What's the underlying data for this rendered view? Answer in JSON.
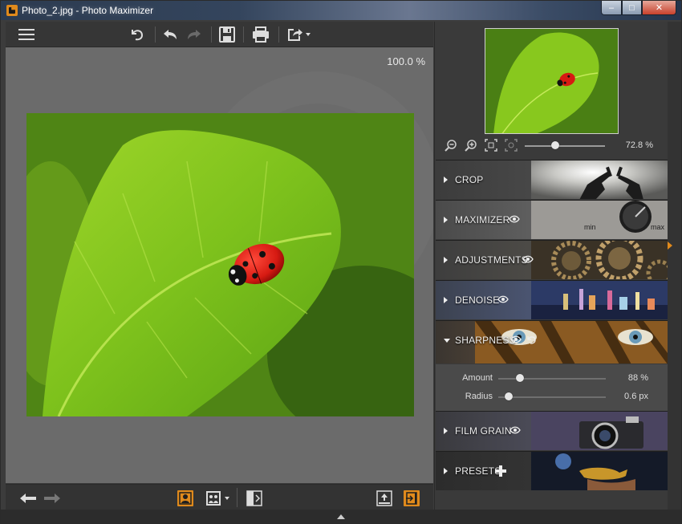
{
  "window": {
    "title": "Photo_2.jpg - Photo Maximizer",
    "controls": {
      "minimize": "–",
      "maximize": "□",
      "close": "✕"
    }
  },
  "toolbar": {
    "items": [
      "menu-icon",
      "undo-all-icon",
      "undo-icon",
      "redo-icon",
      "save-icon",
      "print-icon",
      "export-icon"
    ]
  },
  "canvas": {
    "zoom": "100.0 %"
  },
  "navigator": {
    "zoom": "72.8 %",
    "zoom_level": 0.38
  },
  "sections": [
    {
      "label": "CROP",
      "has_eye": false
    },
    {
      "label": "MAXIMIZER",
      "has_eye": true,
      "dial_min": "min",
      "dial_max": "max"
    },
    {
      "label": "ADJUSTMENTS",
      "has_eye": true
    },
    {
      "label": "DENOISE",
      "has_eye": true
    },
    {
      "label": "SHARPNESS",
      "has_eye": true,
      "has_reset": true,
      "expanded": true
    },
    {
      "label": "FILM GRAIN",
      "has_eye": true
    },
    {
      "label": "PRESETS",
      "has_add": true
    }
  ],
  "sharpness": {
    "amount_label": "Amount",
    "amount_value": "88 %",
    "amount_level": 0.2,
    "radius_label": "Radius",
    "radius_value": "0.6 px",
    "radius_level": 0.1
  },
  "colors": {
    "accent": "#e08a1c",
    "panel": "#3a3a3a",
    "canvas": "#6b6b6b"
  }
}
